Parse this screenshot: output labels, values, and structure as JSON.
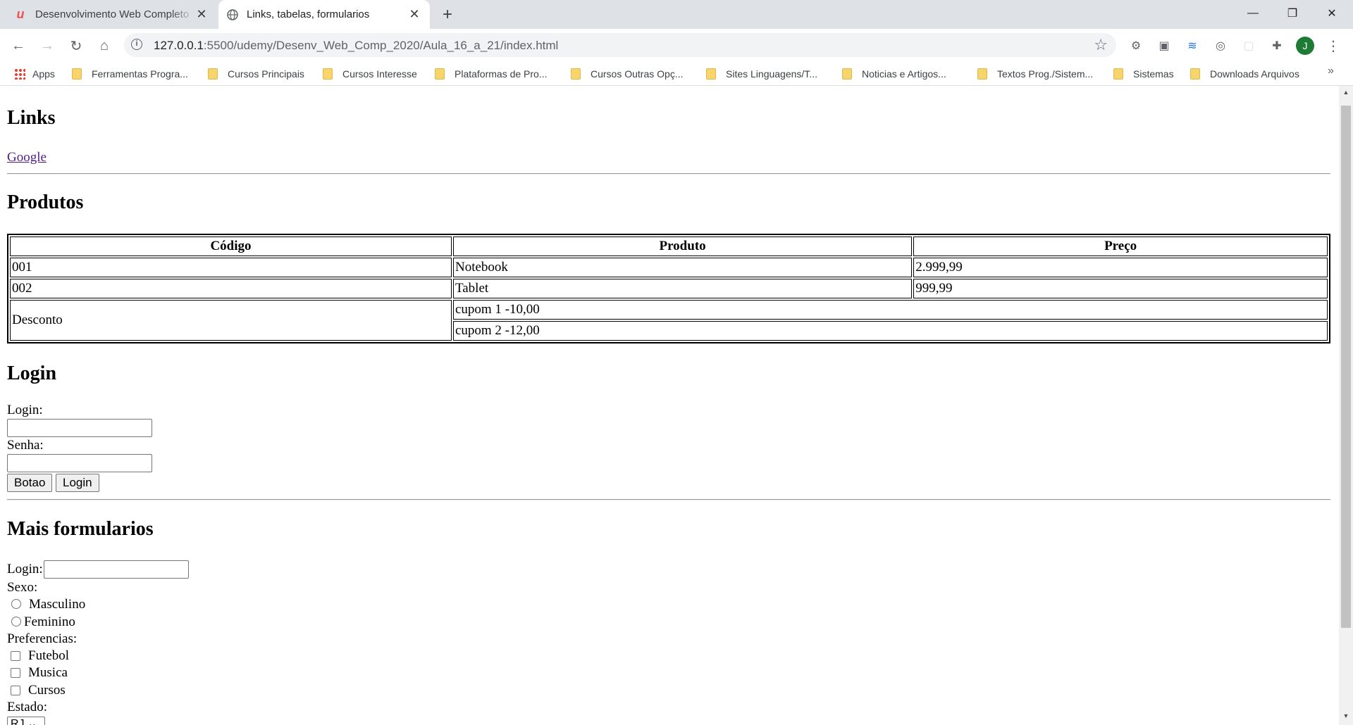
{
  "browser": {
    "tabs": [
      {
        "title": "Desenvolvimento Web Completo",
        "active": false
      },
      {
        "title": "Links, tabelas, formularios",
        "active": true
      }
    ],
    "url_host": "127.0.0.1",
    "url_path": ":5500/udemy/Desenv_Web_Comp_2020/Aula_16_a_21/index.html",
    "avatar_letter": "J",
    "bookmarks": [
      "Apps",
      "Ferramentas Progra...",
      "Cursos Principais",
      "Cursos Interesse",
      "Plataformas de Pro...",
      "Cursos Outras Opç...",
      "Sites Linguagens/T...",
      "Noticias e Artigos...",
      "Textos Prog./Sistem...",
      "Sistemas",
      "Downloads Arquivos"
    ],
    "bookmarks_more": "»"
  },
  "page": {
    "links_heading": "Links",
    "google_link": "Google",
    "produtos_heading": "Produtos",
    "table": {
      "headers": [
        "Código",
        "Produto",
        "Preço"
      ],
      "rows": [
        [
          "001",
          "Notebook",
          "2.999,99"
        ],
        [
          "002",
          "Tablet",
          "999,99"
        ]
      ],
      "discount_label": "Desconto",
      "coupons": [
        "cupom 1 -10,00",
        "cupom 2 -12,00"
      ]
    },
    "login_heading": "Login",
    "login_label": "Login:",
    "senha_label": "Senha:",
    "botao_label": "Botao",
    "login_button": "Login",
    "mais_heading": "Mais formularios",
    "login2_label": "Login:",
    "sexo_label": "Sexo:",
    "sexo_options": [
      "Masculino",
      "Feminino"
    ],
    "pref_label": "Preferencias:",
    "pref_options": [
      "Futebol",
      "Musica",
      "Cursos"
    ],
    "estado_label": "Estado:",
    "estado_value": "RJ"
  }
}
